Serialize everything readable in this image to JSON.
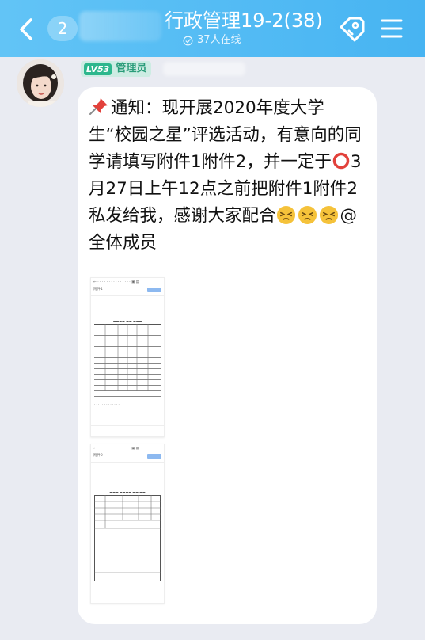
{
  "header": {
    "unread_count": "2",
    "group_title": "行政管理19-2(38)",
    "online_status": "37人在线"
  },
  "sender": {
    "level": "LV53",
    "role": "管理员"
  },
  "message": {
    "text_part1": "通知：现开展2020年度大学生“校园之星”评选活动，有意向的同学请填写附件1附件2，并一定于",
    "text_part2": "3月27日上午12点之前把附件1附件2私发给我，感谢大家配合",
    "text_part3": "@全体成员"
  },
  "attachments": [
    {
      "kind": "document-screenshot",
      "toolbar": "附件1"
    },
    {
      "kind": "document-screenshot",
      "toolbar": "附件2"
    }
  ],
  "colors": {
    "header_start": "#62c4f6",
    "header_end": "#47b4f2",
    "background": "#e9ebf2",
    "badge_green": "#2db78d"
  }
}
